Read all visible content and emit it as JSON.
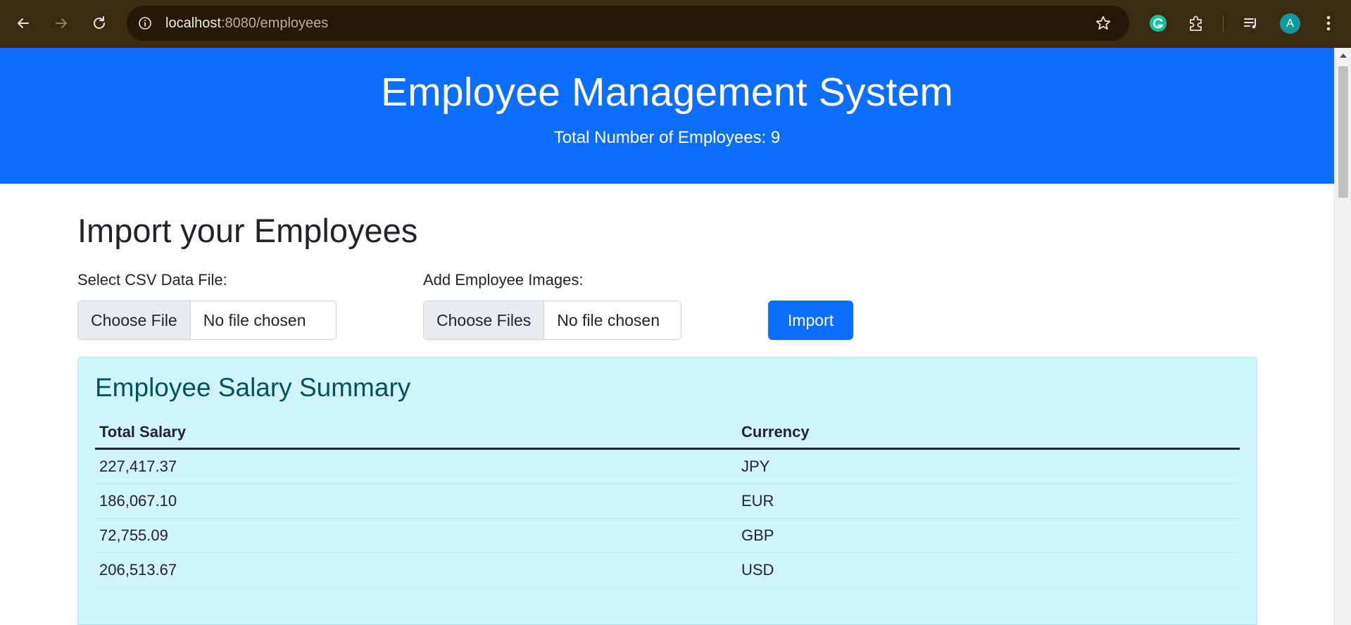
{
  "browser": {
    "url_host": "localhost",
    "url_path": ":8080/employees",
    "avatar_letter": "A"
  },
  "header": {
    "title": "Employee Management System",
    "subtitle": "Total Number of Employees: 9"
  },
  "import_section": {
    "title": "Import your Employees",
    "csv_label": "Select CSV Data File:",
    "csv_button": "Choose File",
    "csv_status": "No file chosen",
    "images_label": "Add Employee Images:",
    "images_button": "Choose Files",
    "images_status": "No file chosen",
    "import_button": "Import"
  },
  "summary": {
    "title": "Employee Salary Summary",
    "columns": [
      "Total Salary",
      "Currency"
    ],
    "rows": [
      [
        "227,417.37",
        "JPY"
      ],
      [
        "186,067.10",
        "EUR"
      ],
      [
        "72,755.09",
        "GBP"
      ],
      [
        "206,513.67",
        "USD"
      ]
    ]
  },
  "colors": {
    "chrome": "#3b2a10",
    "primary": "#0d6efd",
    "info_bg": "#cff4fc",
    "info_text": "#055160"
  }
}
